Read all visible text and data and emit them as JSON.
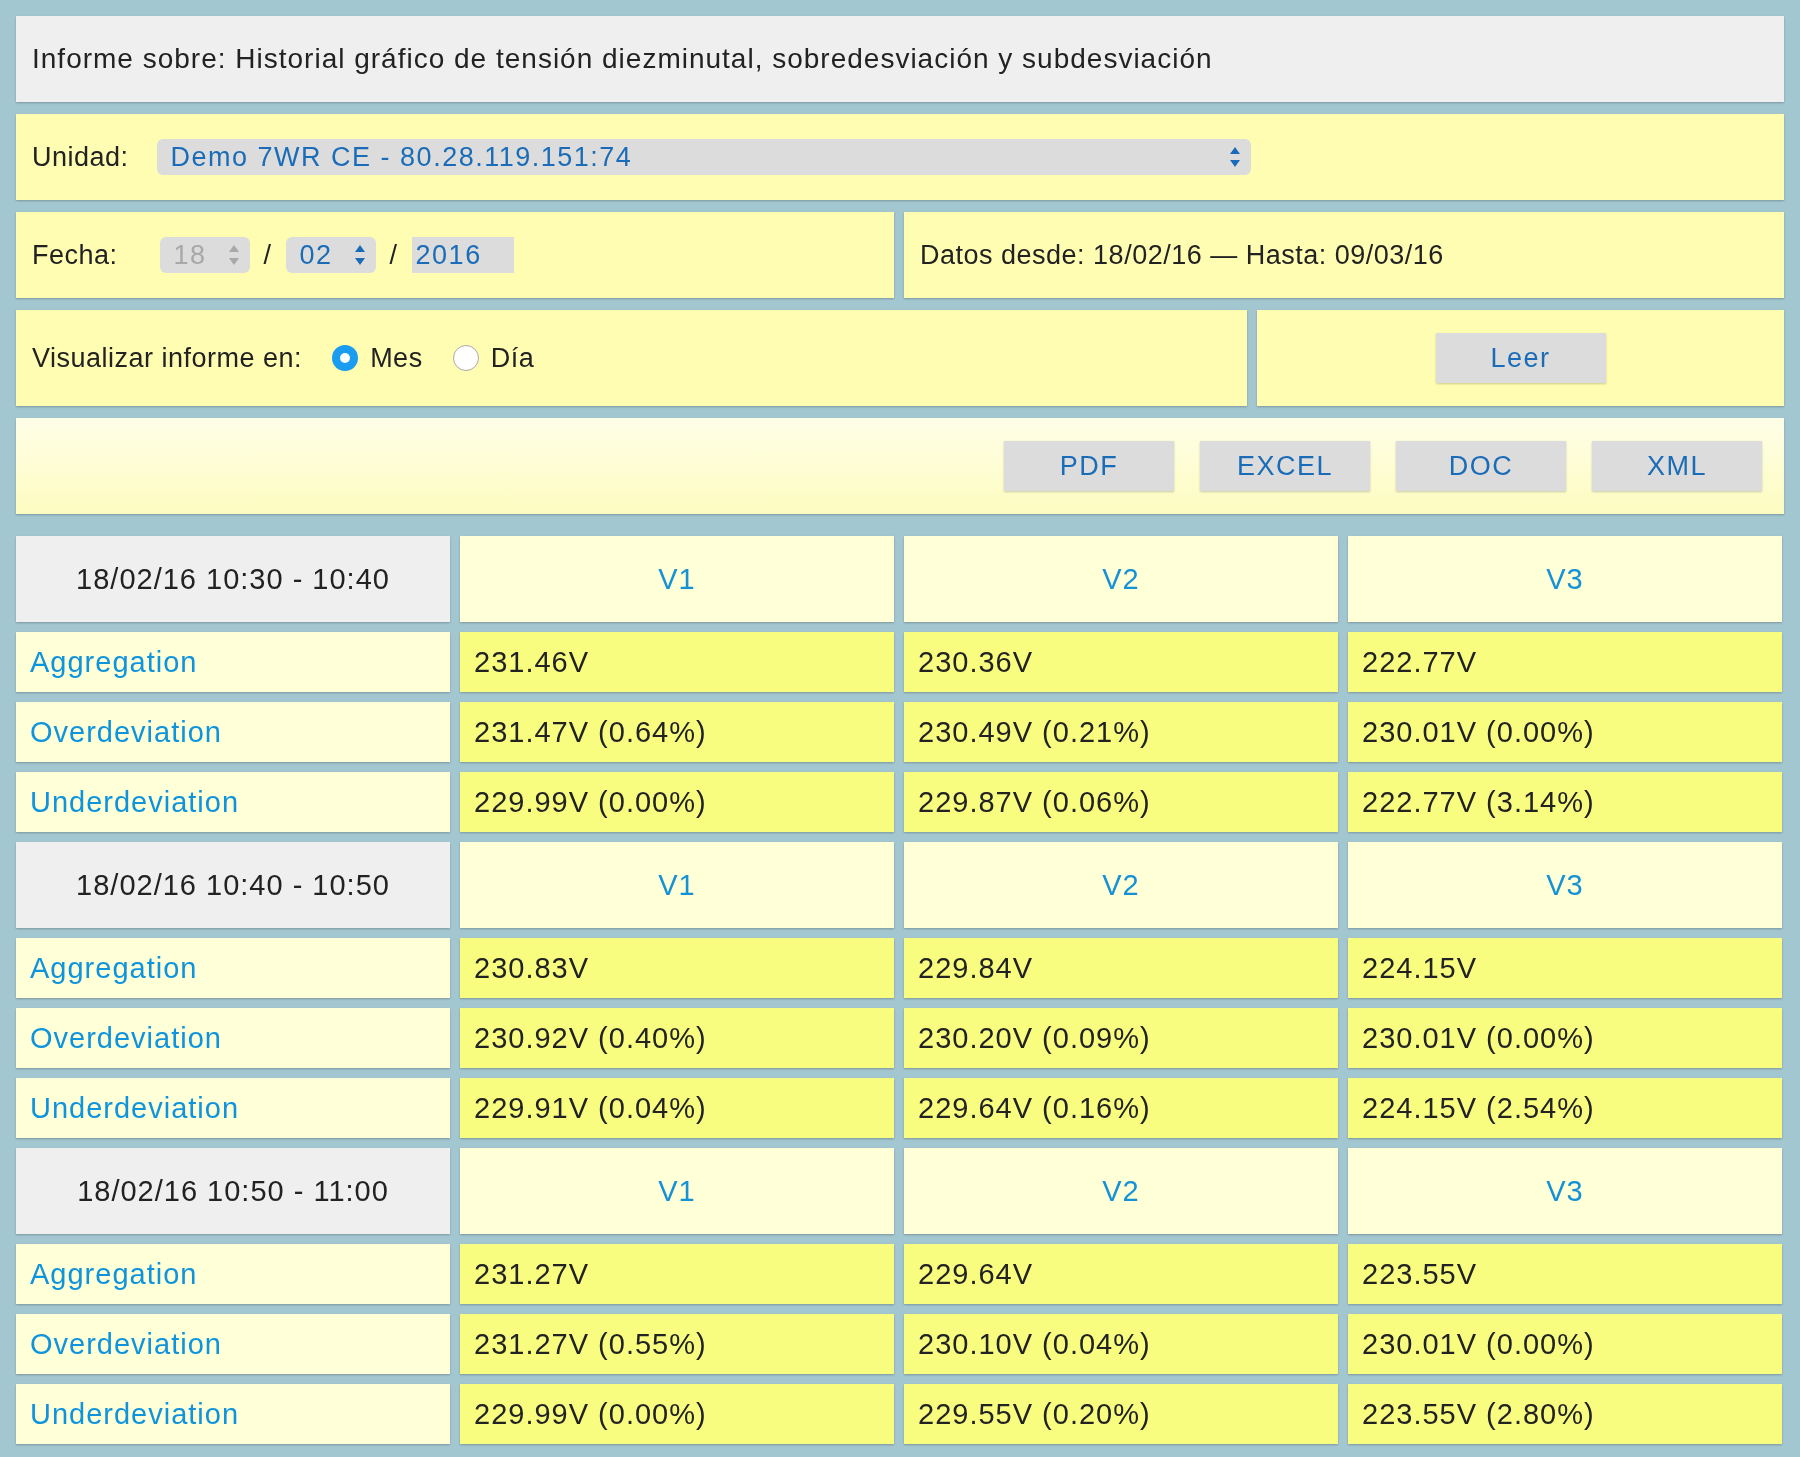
{
  "title": "Informe sobre: Historial gráfico de tensión diezminutal, sobredesviación y subdesviación",
  "unit": {
    "label": "Unidad:",
    "value": "Demo 7WR CE - 80.28.119.151:74"
  },
  "date": {
    "label": "Fecha:",
    "fields": [
      {
        "kind": "select",
        "value": "18",
        "disabled": true
      },
      {
        "kind": "separator",
        "value": "/"
      },
      {
        "kind": "select",
        "value": "02",
        "disabled": false
      },
      {
        "kind": "separator",
        "value": "/"
      },
      {
        "kind": "input",
        "value": "2016",
        "disabled": false
      }
    ]
  },
  "data_range": "Datos desde: 18/02/16 — Hasta: 09/03/16",
  "view": {
    "label": "Visualizar informe en:",
    "options": [
      {
        "label": "Mes",
        "selected": true
      },
      {
        "label": "Día",
        "selected": false
      }
    ]
  },
  "read_button": "Leer",
  "export_buttons": [
    "PDF",
    "EXCEL",
    "DOC",
    "XML"
  ],
  "groups": [
    {
      "period": "18/02/16 10:30 - 10:40",
      "columns": [
        "V1",
        "V2",
        "V3"
      ],
      "rows": [
        {
          "label": "Aggregation",
          "values": [
            "231.46V",
            "230.36V",
            "222.77V"
          ]
        },
        {
          "label": "Overdeviation",
          "values": [
            "231.47V (0.64%)",
            "230.49V (0.21%)",
            "230.01V (0.00%)"
          ]
        },
        {
          "label": "Underdeviation",
          "values": [
            "229.99V (0.00%)",
            "229.87V (0.06%)",
            "222.77V (3.14%)"
          ]
        }
      ]
    },
    {
      "period": "18/02/16 10:40 - 10:50",
      "columns": [
        "V1",
        "V2",
        "V3"
      ],
      "rows": [
        {
          "label": "Aggregation",
          "values": [
            "230.83V",
            "229.84V",
            "224.15V"
          ]
        },
        {
          "label": "Overdeviation",
          "values": [
            "230.92V (0.40%)",
            "230.20V (0.09%)",
            "230.01V (0.00%)"
          ]
        },
        {
          "label": "Underdeviation",
          "values": [
            "229.91V (0.04%)",
            "229.64V (0.16%)",
            "224.15V (2.54%)"
          ]
        }
      ]
    },
    {
      "period": "18/02/16 10:50 - 11:00",
      "columns": [
        "V1",
        "V2",
        "V3"
      ],
      "rows": [
        {
          "label": "Aggregation",
          "values": [
            "231.27V",
            "229.64V",
            "223.55V"
          ]
        },
        {
          "label": "Overdeviation",
          "values": [
            "231.27V (0.55%)",
            "230.10V (0.04%)",
            "230.01V (0.00%)"
          ]
        },
        {
          "label": "Underdeviation",
          "values": [
            "229.99V (0.00%)",
            "229.55V (0.20%)",
            "223.55V (2.80%)"
          ]
        }
      ]
    }
  ]
}
